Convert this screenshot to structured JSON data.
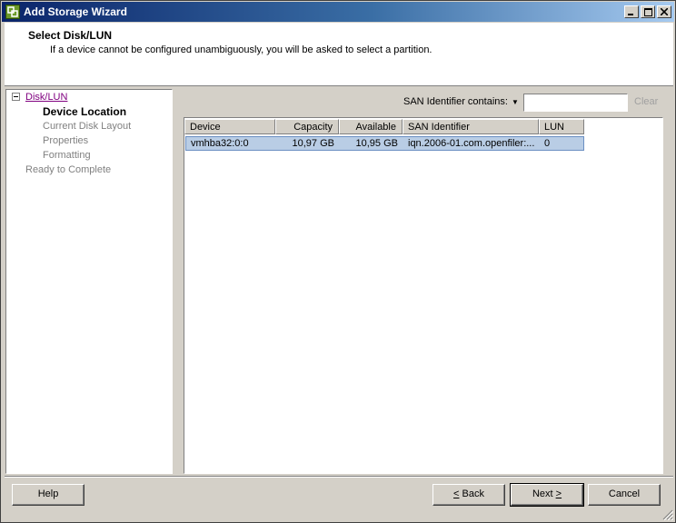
{
  "window": {
    "title": "Add Storage Wizard",
    "app_icon": "vmware-icon"
  },
  "header": {
    "title": "Select Disk/LUN",
    "subtitle": "If a device cannot be configured unambiguously, you will be asked to select a partition."
  },
  "nav": {
    "items": [
      {
        "label": "Disk/LUN",
        "state": "link"
      },
      {
        "label": "Device Location",
        "state": "current"
      },
      {
        "label": "Current Disk Layout",
        "state": "disabled"
      },
      {
        "label": "Properties",
        "state": "disabled"
      },
      {
        "label": "Formatting",
        "state": "disabled"
      },
      {
        "label": "Ready to Complete",
        "state": "disabled"
      }
    ]
  },
  "filter": {
    "label": "SAN Identifier contains:",
    "value": "",
    "clear_label": "Clear"
  },
  "table": {
    "columns": [
      "Device",
      "Capacity",
      "Available",
      "SAN Identifier",
      "LUN"
    ],
    "rows": [
      {
        "device": "vmhba32:0:0",
        "capacity": "10,97 GB",
        "available": "10,95 GB",
        "san_identifier": "iqn.2006-01.com.openfiler:...",
        "lun": "0",
        "selected": true
      }
    ]
  },
  "buttons": {
    "help": "Help",
    "back_prefix": "",
    "back_key": "<",
    "back_rest": " Back",
    "next_prefix": "Next ",
    "next_key": ">",
    "cancel": "Cancel"
  },
  "colors": {
    "selection": "#b9cde5",
    "link": "#800080",
    "disabled": "#808080"
  }
}
